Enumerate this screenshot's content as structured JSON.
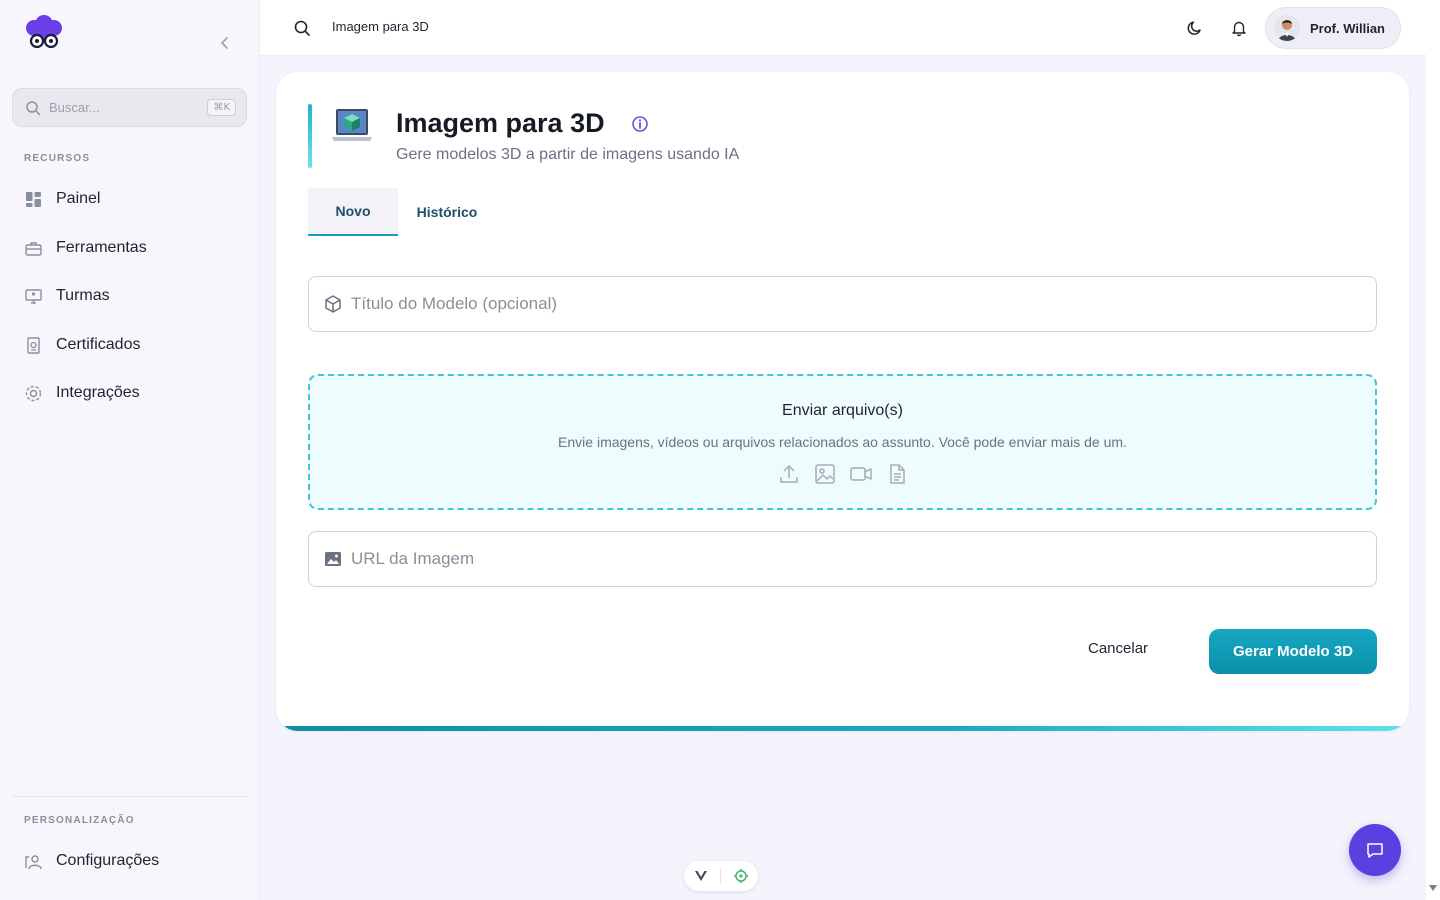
{
  "sidebar": {
    "search_placeholder": "Buscar...",
    "search_shortcut": "⌘K",
    "section_resources": "RECURSOS",
    "items": [
      {
        "label": "Painel",
        "icon": "dashboard-icon"
      },
      {
        "label": "Ferramentas",
        "icon": "toolbox-icon"
      },
      {
        "label": "Turmas",
        "icon": "classroom-icon"
      },
      {
        "label": "Certificados",
        "icon": "certificate-icon"
      },
      {
        "label": "Integrações",
        "icon": "gear-icon"
      }
    ],
    "section_personalization": "PERSONALIZAÇÃO",
    "settings_label": "Configurações"
  },
  "header": {
    "breadcrumb": "Imagem para 3D",
    "user_name": "Prof. Willian"
  },
  "page": {
    "title": "Imagem para 3D",
    "subtitle": "Gere modelos 3D a partir de imagens usando IA",
    "tabs": [
      {
        "label": "Novo",
        "active": true
      },
      {
        "label": "Histórico",
        "active": false
      }
    ],
    "title_field_placeholder": "Título do Modelo (opcional)",
    "upload": {
      "title": "Enviar arquivo(s)",
      "description": "Envie imagens, vídeos ou arquivos relacionados ao assunto. Você pode enviar mais de um."
    },
    "url_field_placeholder": "URL da Imagem",
    "cancel_label": "Cancelar",
    "submit_label": "Gerar Modelo 3D"
  },
  "colors": {
    "accent": "#1aa9c6",
    "brand": "#5b3fe0",
    "dropzone_border": "#3ec7d9"
  }
}
